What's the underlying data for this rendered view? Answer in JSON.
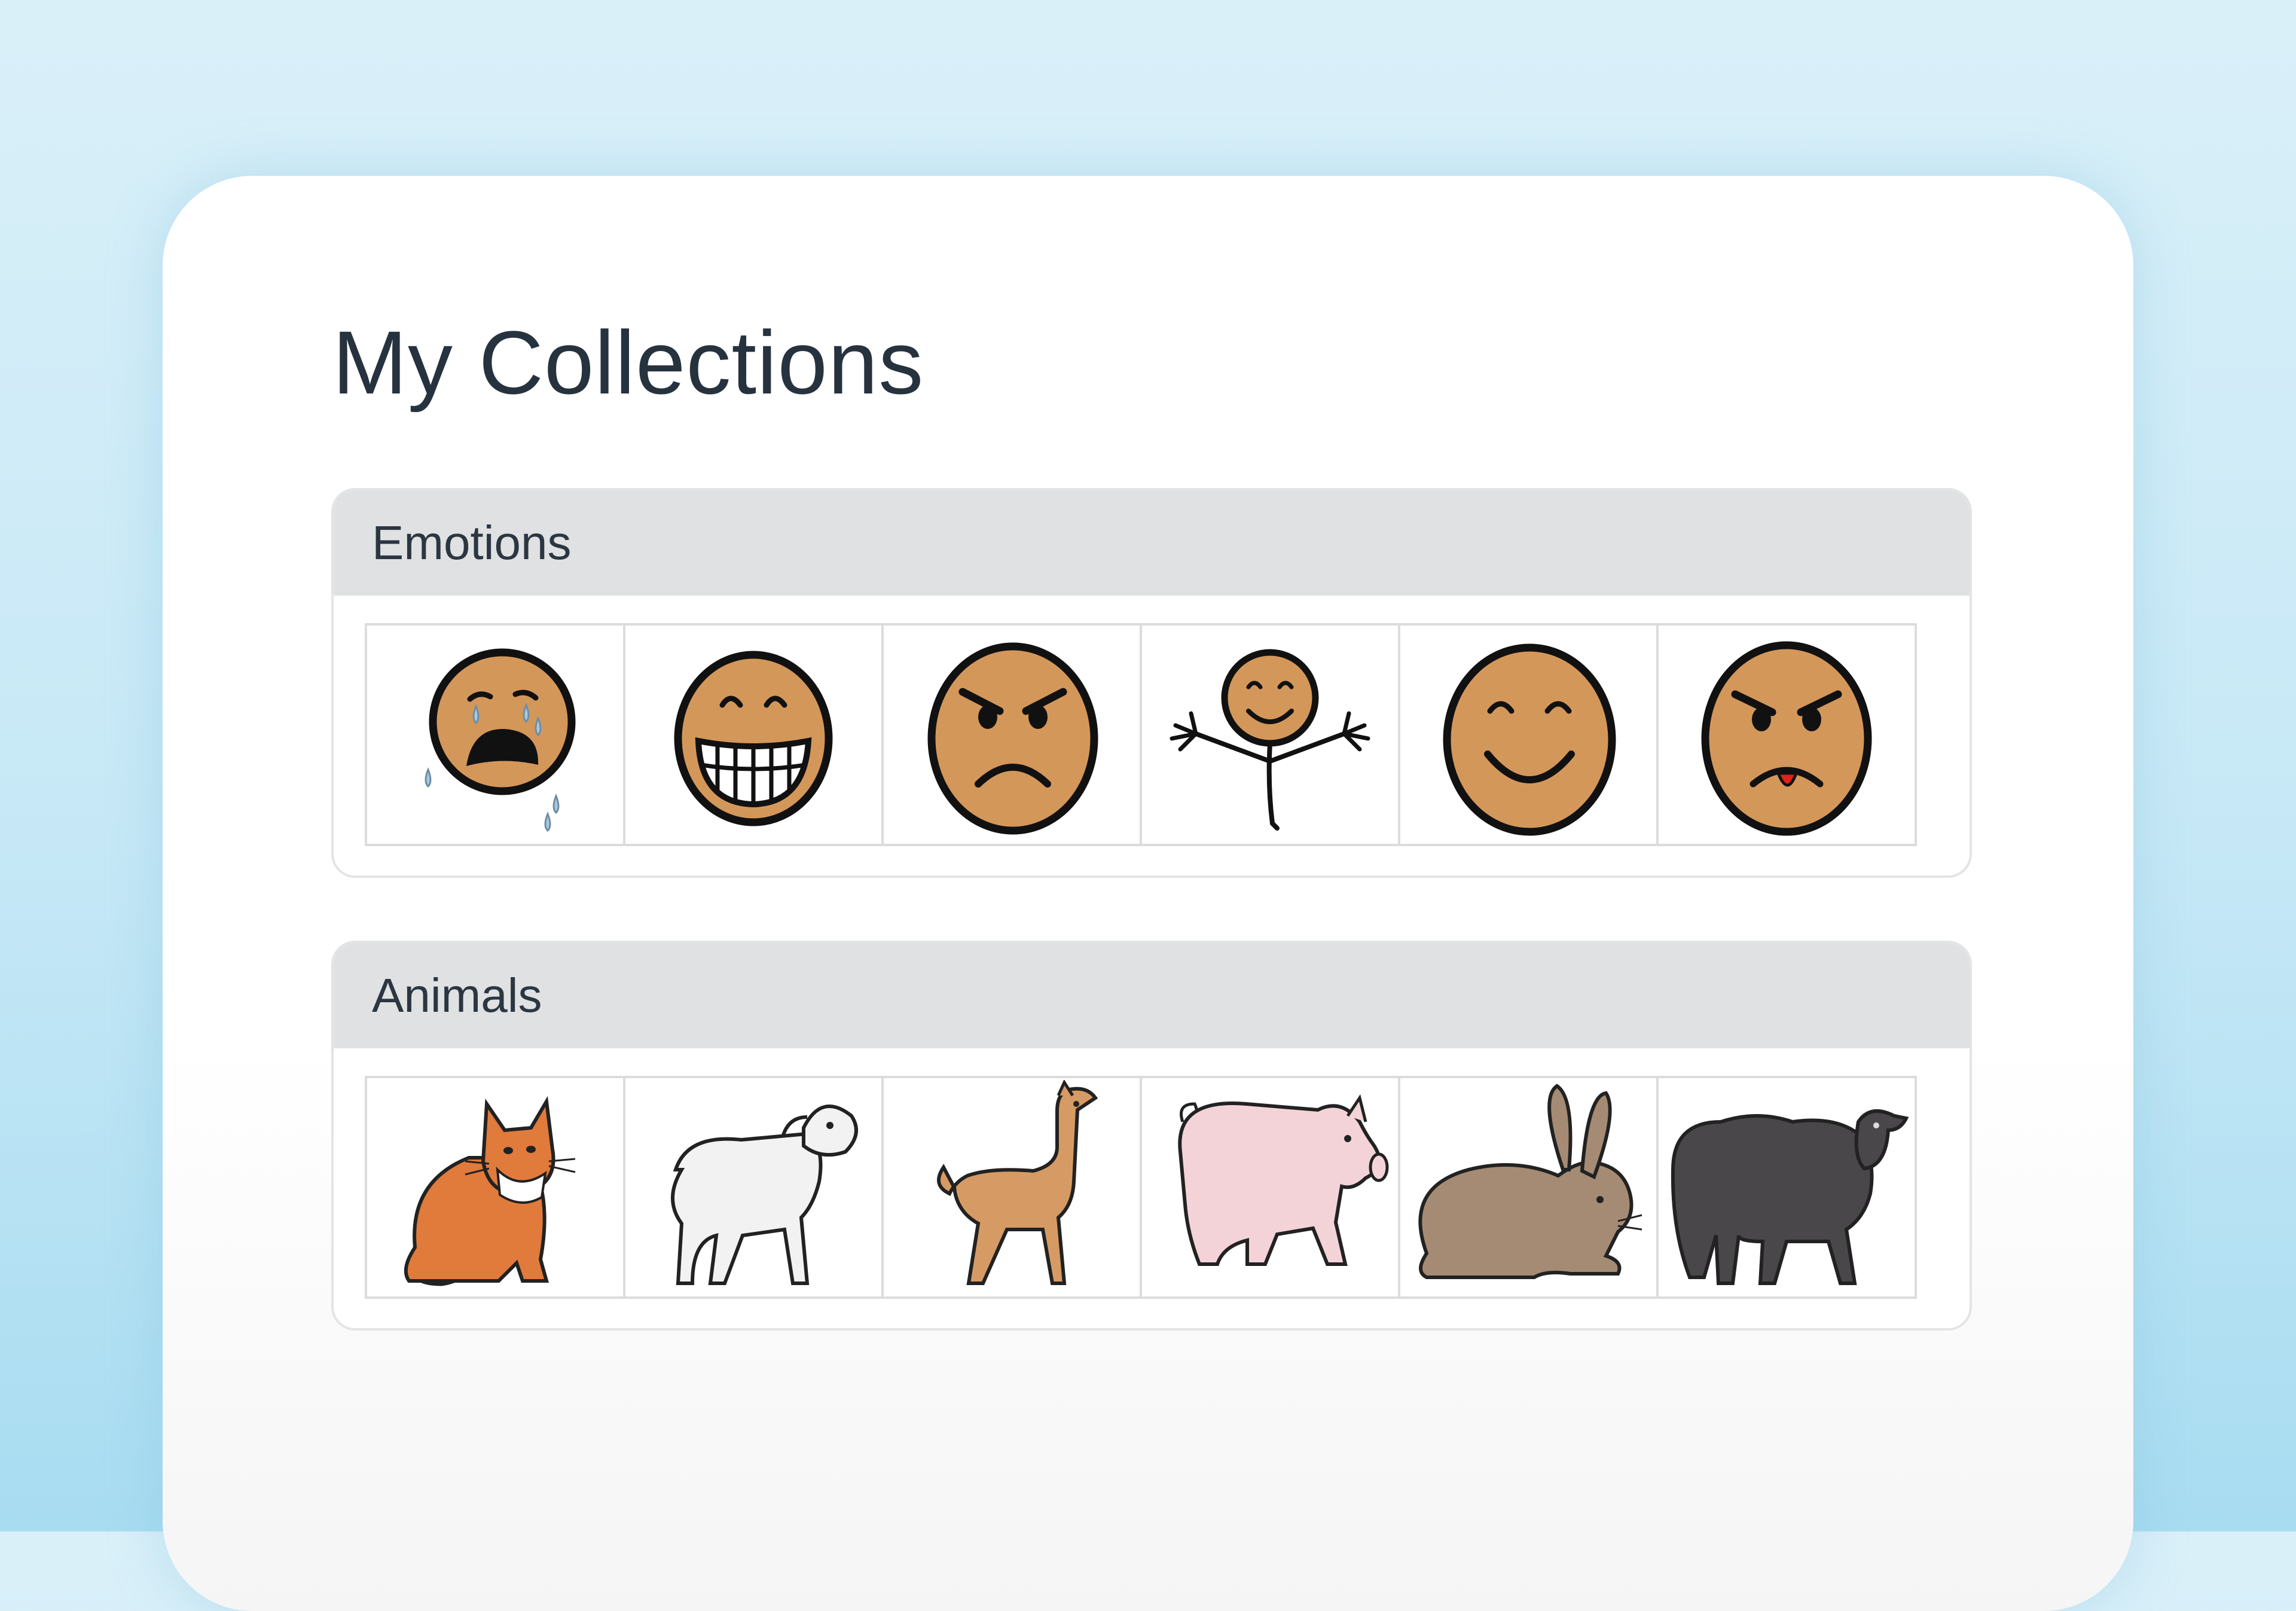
{
  "page": {
    "title": "My Collections"
  },
  "collections": [
    {
      "name": "Emotions",
      "symbols": [
        {
          "icon": "crying-face-icon"
        },
        {
          "icon": "grinning-face-icon"
        },
        {
          "icon": "angry-face-icon"
        },
        {
          "icon": "happy-person-icon"
        },
        {
          "icon": "smiling-face-icon"
        },
        {
          "icon": "disgusted-face-icon"
        }
      ]
    },
    {
      "name": "Animals",
      "symbols": [
        {
          "icon": "cat-icon"
        },
        {
          "icon": "lamb-icon"
        },
        {
          "icon": "llama-icon"
        },
        {
          "icon": "pig-icon"
        },
        {
          "icon": "rabbit-icon"
        },
        {
          "icon": "black-sheep-icon"
        }
      ]
    }
  ],
  "colors": {
    "background": "#c6e8f6",
    "card": "#ffffff",
    "header": "#dfe1e2",
    "face": "#d4975a",
    "title_text": "#27323f"
  }
}
